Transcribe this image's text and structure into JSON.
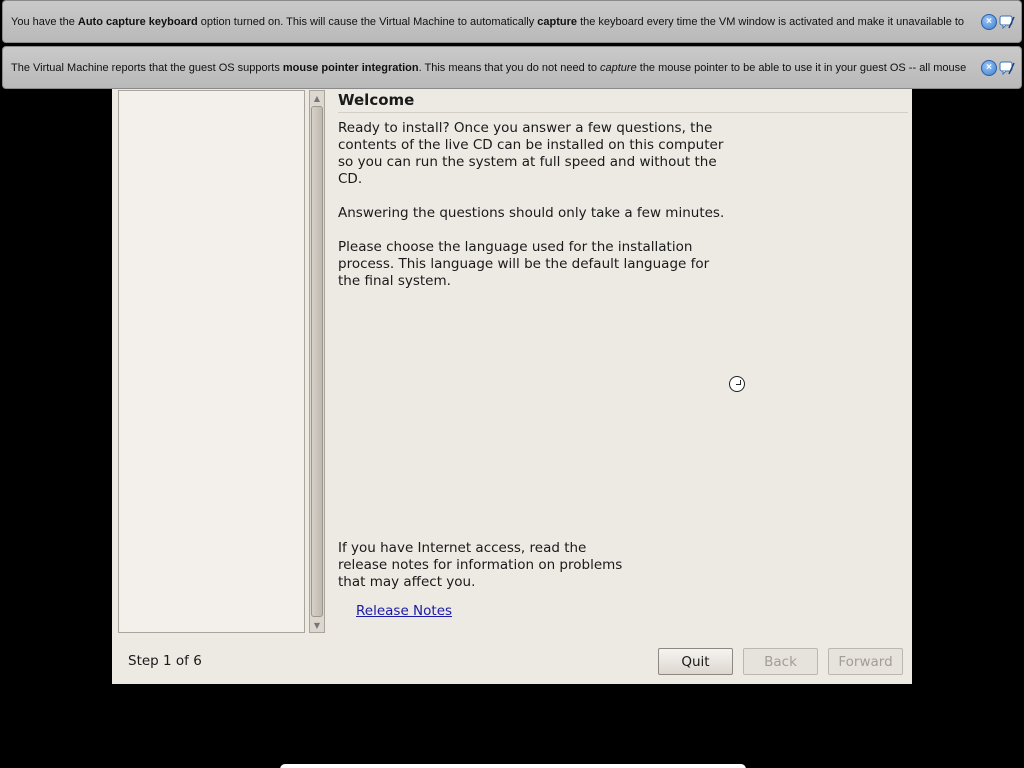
{
  "banners": [
    {
      "segments": [
        {
          "text": "You have the ",
          "bold": false
        },
        {
          "text": "Auto capture keyboard",
          "bold": true
        },
        {
          "text": " option turned on. This will cause the Virtual Machine to automatically ",
          "bold": false
        },
        {
          "text": "capture",
          "bold": true
        },
        {
          "text": " the keyboard every time the VM window is activated and make it unavailable to",
          "bold": false
        }
      ]
    },
    {
      "segments": [
        {
          "text": "The Virtual Machine reports that the guest OS supports ",
          "bold": false
        },
        {
          "text": "mouse pointer integration",
          "bold": true
        },
        {
          "text": ". This means that you do not need to ",
          "bold": false
        },
        {
          "text": "capture",
          "italic": true
        },
        {
          "text": " the mouse pointer to be able to use it in your guest OS -- all mouse",
          "bold": false
        }
      ]
    }
  ],
  "banner_icons": {
    "close": "close-icon",
    "message": "message-icon"
  },
  "installer": {
    "title": "Welcome",
    "para1": "Ready to install? Once you answer a few questions, the contents of the live CD can be installed on this computer so you can run the system at full speed and without the CD.",
    "para2": "Answering the questions should only take a few minutes.",
    "para3": "Please choose the language used for the installation process. This language will be the default language for the final system.",
    "para4": "If you have Internet access, read the release notes for information on problems that may affect you.",
    "release_notes_link": "Release Notes",
    "step_label": "Step 1 of 6",
    "buttons": {
      "quit": "Quit",
      "back": "Back",
      "forward": "Forward"
    }
  }
}
